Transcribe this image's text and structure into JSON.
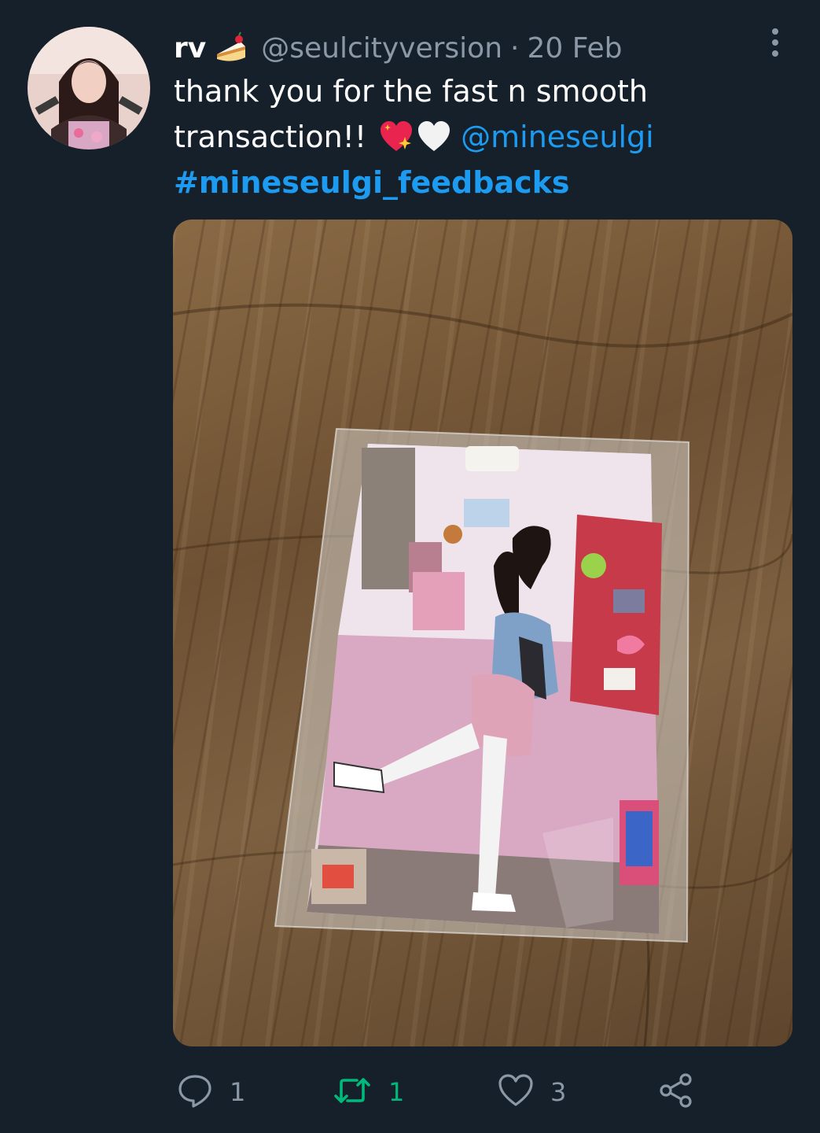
{
  "tweet": {
    "display_name": "rv",
    "name_emoji": "cake-emoji",
    "handle": "@seulcityversion",
    "separator": "·",
    "date": "20 Feb",
    "text_line1": "thank you for the fast n smooth",
    "text_line2": "transaction!!",
    "emojis": [
      "sparkling-heart-emoji",
      "white-heart-emoji"
    ],
    "mention": "@mineseulgi",
    "hashtag": "#mineseulgi_feedbacks"
  },
  "actions": {
    "reply_count": "1",
    "retweet_count": "1",
    "like_count": "3"
  },
  "colors": {
    "background": "#15202b",
    "text": "#ffffff",
    "muted": "#8b98a5",
    "link": "#1d9bf0",
    "retweet": "#00ba7c"
  },
  "icons": {
    "more": "more-vertical-icon",
    "reply": "reply-icon",
    "retweet": "retweet-icon",
    "like": "heart-icon",
    "share": "share-icon"
  }
}
